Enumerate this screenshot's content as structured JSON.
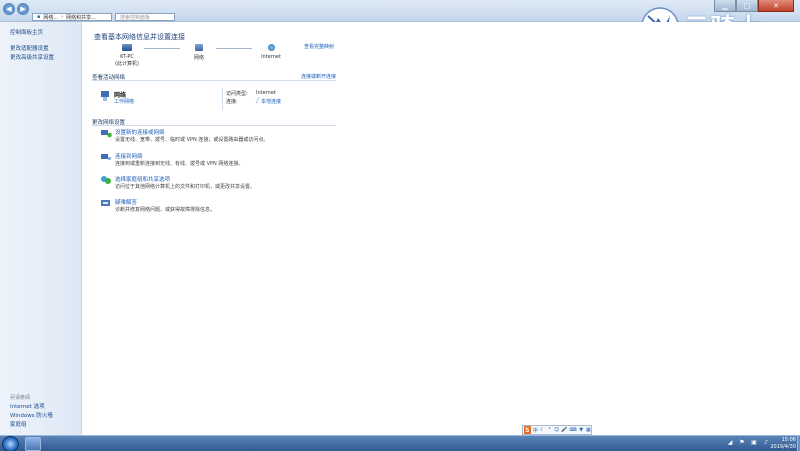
{
  "address": {
    "segments": [
      "网络...",
      "网络和共享..."
    ],
    "search_placeholder": "搜索控制面板"
  },
  "sidebar": {
    "home": "控制面板主页",
    "links": [
      "更改适配器设置",
      "更改高级共享设置"
    ],
    "see_also_title": "另请参阅",
    "see_also": [
      "Internet 选项",
      "Windows 防火墙",
      "家庭组"
    ]
  },
  "main": {
    "title": "查看基本网络信息并设置连接",
    "view_full_map": "查看完整映射",
    "map": {
      "computer_name": "KT-PC",
      "computer_sub": "(此计算机)",
      "network": "网络",
      "internet": "Internet"
    },
    "active_networks": {
      "title": "查看活动网络",
      "connect_disconnect": "连接或断开连接",
      "network_name": "网络",
      "network_type": "工作网络",
      "access_type_label": "访问类型:",
      "access_type_value": "Internet",
      "connections_label": "连接:",
      "connections_value": "本地连接"
    },
    "change_settings": {
      "title": "更改网络设置",
      "tasks": [
        {
          "link": "设置新的连接或网络",
          "desc": "设置无线、宽带、拨号、临时或 VPN 连接；或设置路由器或访问点。"
        },
        {
          "link": "连接到网络",
          "desc": "连接到或重新连接到无线、有线、拨号或 VPN 网络连接。"
        },
        {
          "link": "选择家庭组和共享选项",
          "desc": "访问位于其他网络计算机上的文件和打印机，或更改共享设置。"
        },
        {
          "link": "疑难解答",
          "desc": "诊断并修复网络问题，或获得故障排除信息。"
        }
      ]
    }
  },
  "watermark": {
    "text": "云骑士"
  },
  "taskbar": {
    "time": "15:06",
    "date": "2019/4/30"
  },
  "colors": {
    "link": "#1d5fb8",
    "title": "#1e3f78",
    "taskbar": "#2f5a92",
    "ime_logo": "#e86a1a"
  }
}
